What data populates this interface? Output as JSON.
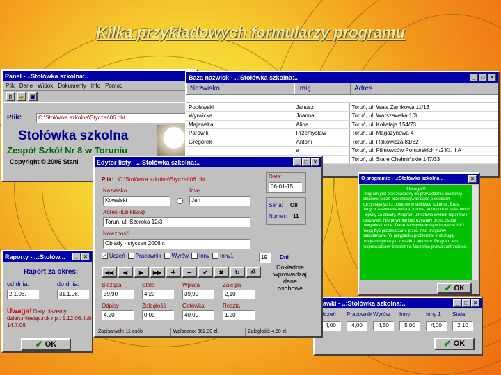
{
  "slide_title": "Kilka przykładowych formularzy programu",
  "main_window": {
    "title": "Panel - ..Stołówka szkolna:..",
    "menu": [
      "Plik",
      "Dane",
      "Widok",
      "Dokumenty",
      "Info",
      "Pomoc"
    ],
    "file_label": "Plik:",
    "file_value": "C:\\Stołówka szkolna\\Styczeń06.dbf",
    "app_name": "Stołówka szkolna",
    "school": "Zespół Szkół Nr 8 w Toruniu",
    "copyright": "Copyright © 2006 Stani"
  },
  "names_window": {
    "title": "Baza nazwisk - ..:Stołówka szkolna:..",
    "columns": [
      "Nazwisko",
      "Imię",
      "Adres"
    ],
    "rows": [
      [
        "Popławski",
        "Janusz",
        "Toruń, ul. Wała Zamkowa 11/13"
      ],
      [
        "Wyrwicka",
        "Joanna",
        "Toruń, ul. Warszawska 1/3"
      ],
      [
        "Majewska",
        "Alina",
        "Toruń, ul. Kołłątaja 154/73"
      ],
      [
        "Parowik",
        "Przemysław",
        "Toruń, ul. Magazynowa 4"
      ],
      [
        "Gregorek",
        "Antoni",
        "Toruń, ul. Rakowicza 81/82"
      ],
      [
        "",
        "a",
        "Toruń, ul. Filmowców Pomorskich 4/2   Kl. II A"
      ],
      [
        "",
        "",
        "Toruń, ul. Stare Chełmińskie 147/33"
      ]
    ],
    "partial": [
      "a",
      "e",
      "a"
    ]
  },
  "about_window": {
    "title": "O programie - ..:Stołówka szkolna:..",
    "heading": "Uwaga!!!",
    "body": "Program jest przeznaczony do prowadzenia ewidencji obiadów. Może przechowywać dane o osobach korzystających z obiadów w stołówce szkolnej. Baza danych zawiera nazwiska, imiona, adresy oraz należności i wpłaty za obiady. Program umożliwia wydruk raportów i zestawień. Nie powinien być używany przez osoby nieupoważnione. Dane zapisywane są w formacie dbf i mogą być przetwarzane przez inne programy bazodanowe. W przypadku problemów z obsługą programu proszę o kontakt z autorem. Program jest rozprowadzany bezpłatnie. Wszelkie prawa zastrzeżone.",
    "ok": "OK"
  },
  "editor_window": {
    "title": "Edytor listy - ..:Stołówka szkolna:..",
    "file_label": "Plik:",
    "file_value": "C:\\Stołówka szkolna\\Styczeń06.dbf",
    "surname_label": "Nazwisko",
    "surname": "Kowalski",
    "name_label": "Imię",
    "name": "Jan",
    "address_label": "Adres (lub klasa)",
    "address": "Toruń, ul. Szeroka 12/3",
    "due_label": "Należność",
    "due": "Obiady - styczeń 2006 r.",
    "date_label": "Data:",
    "date": "06-01-15",
    "series_label": "Seria:",
    "series": "O8",
    "number_label": "Numer:",
    "number": "11",
    "checks": [
      "Uczeń",
      "Pracownik",
      "Wyrów",
      "Inny",
      "Inny1"
    ],
    "days_value": "19",
    "days_label": "Dni",
    "amounts": [
      {
        "label": "Bieżąca",
        "value": "39,90"
      },
      {
        "label": "Stała",
        "value": "4,20"
      },
      {
        "label": "Wpłata",
        "value": "39,90"
      },
      {
        "label": "Zaległa",
        "value": "2,10"
      },
      {
        "label": "Odpisy",
        "value": "4,20"
      },
      {
        "label": "Zaległość",
        "value": "0,00"
      },
      {
        "label": "Gotówka",
        "value": "40,00"
      },
      {
        "label": "Reszta",
        "value": "1,20"
      }
    ],
    "status": [
      "Zapisanych: 11 osób",
      "Wpłacono: 362,30 zł.",
      "Zaległość: 4,50 zł."
    ],
    "nav": [
      "◀◀",
      "◀",
      "▶",
      "▶▶",
      "✚",
      "━",
      "✔",
      "✖",
      "↻",
      "⎙"
    ]
  },
  "reports_window": {
    "title": "Raporty - ..:Stołów...",
    "heading": "Raport za okres:",
    "from_label": "od dnia:",
    "from": "2.1.06.",
    "to_label": "do dnia:",
    "to": "31.1.06.",
    "warning_bold": "Uwaga!",
    "warning": "Daty piszemy: dzień.miesiąc.rok np.: 1.12.06. lub 14.7.06.",
    "ok": "OK"
  },
  "rates_window": {
    "title": "Stawki - ..:Stołówka szkolna:..",
    "labels": [
      "Uczeń",
      "Pracownik",
      "Wyrów.",
      "Inny",
      "Inny 1",
      "Stała"
    ],
    "values": [
      "4,00",
      "4,00",
      "4,50",
      "5,00",
      "4,00",
      "2,10"
    ],
    "ok": "OK"
  },
  "caption": [
    "Dokładnie",
    "wprowadzaj",
    "dane",
    "osobowe"
  ],
  "colors": {
    "title_bar": "#0000a8",
    "window": "#c0c0c0",
    "about_bg": "#00c000",
    "label": "#8b0000",
    "caption": "#1e3a8a"
  }
}
